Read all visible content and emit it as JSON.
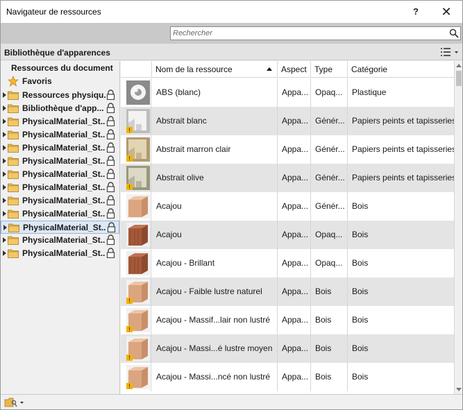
{
  "window": {
    "title": "Navigateur de ressources",
    "help_label": "?",
    "close_label": "✕"
  },
  "search": {
    "placeholder": "Rechercher",
    "value": ""
  },
  "library": {
    "title": "Bibliothèque d'apparences"
  },
  "tree": {
    "document_resources": "Ressources du document",
    "favorites": "Favoris",
    "items": [
      {
        "label": "Ressources physiqu...",
        "locked": true,
        "selected": false
      },
      {
        "label": "Bibliothèque d'app...",
        "locked": true,
        "selected": false
      },
      {
        "label": "PhysicalMaterial_St...",
        "locked": true,
        "selected": false
      },
      {
        "label": "PhysicalMaterial_St...",
        "locked": true,
        "selected": false
      },
      {
        "label": "PhysicalMaterial_St...",
        "locked": true,
        "selected": false
      },
      {
        "label": "PhysicalMaterial_St...",
        "locked": true,
        "selected": false
      },
      {
        "label": "PhysicalMaterial_St...",
        "locked": true,
        "selected": false
      },
      {
        "label": "PhysicalMaterial_St...",
        "locked": true,
        "selected": false
      },
      {
        "label": "PhysicalMaterial_St...",
        "locked": true,
        "selected": false
      },
      {
        "label": "PhysicalMaterial_St...",
        "locked": true,
        "selected": false
      },
      {
        "label": "PhysicalMaterial_St...",
        "locked": true,
        "selected": true
      },
      {
        "label": "PhysicalMaterial_St...",
        "locked": true,
        "selected": false
      },
      {
        "label": "PhysicalMaterial_St...",
        "locked": true,
        "selected": false
      }
    ]
  },
  "table": {
    "columns": [
      "Nom de la ressource",
      "Aspect",
      "Type",
      "Catégorie"
    ],
    "sort_column": "Nom de la ressource",
    "rows": [
      {
        "name": "ABS (blanc)",
        "aspect": "Appa...",
        "type": "Opaq...",
        "category": "Plastique",
        "thumb": "white-plastic",
        "warning": false
      },
      {
        "name": "Abstrait blanc",
        "aspect": "Appa...",
        "type": "Génér...",
        "category": "Papiers peints et tapisseries",
        "thumb": "white-abstract",
        "warning": true
      },
      {
        "name": "Abstrait marron clair",
        "aspect": "Appa...",
        "type": "Génér...",
        "category": "Papiers peints et tapisseries",
        "thumb": "tan-abstract",
        "warning": true
      },
      {
        "name": "Abstrait olive",
        "aspect": "Appa...",
        "type": "Génér...",
        "category": "Papiers peints et tapisseries",
        "thumb": "olive-abstract",
        "warning": true
      },
      {
        "name": "Acajou",
        "aspect": "Appa...",
        "type": "Génér...",
        "category": "Bois",
        "thumb": "light-wood",
        "warning": false
      },
      {
        "name": "Acajou",
        "aspect": "Appa...",
        "type": "Opaq...",
        "category": "Bois",
        "thumb": "dark-wood",
        "warning": false
      },
      {
        "name": "Acajou - Brillant",
        "aspect": "Appa...",
        "type": "Opaq...",
        "category": "Bois",
        "thumb": "dark-wood",
        "warning": false
      },
      {
        "name": "Acajou - Faible lustre naturel",
        "aspect": "Appa...",
        "type": "Bois",
        "category": "Bois",
        "thumb": "light-wood",
        "warning": true
      },
      {
        "name": "Acajou - Massif...lair non lustré",
        "aspect": "Appa...",
        "type": "Bois",
        "category": "Bois",
        "thumb": "light-wood",
        "warning": true
      },
      {
        "name": "Acajou - Massi...é lustre moyen",
        "aspect": "Appa...",
        "type": "Bois",
        "category": "Bois",
        "thumb": "light-wood",
        "warning": true
      },
      {
        "name": "Acajou - Massi...ncé non lustré",
        "aspect": "Appa...",
        "type": "Bois",
        "category": "Bois",
        "thumb": "light-wood",
        "warning": true
      }
    ]
  },
  "colors": {
    "selection_bg": "#dde8f5",
    "row_alt_bg": "#e4e4e4",
    "folder": "#e8b64c",
    "warning": "#f0b400"
  }
}
